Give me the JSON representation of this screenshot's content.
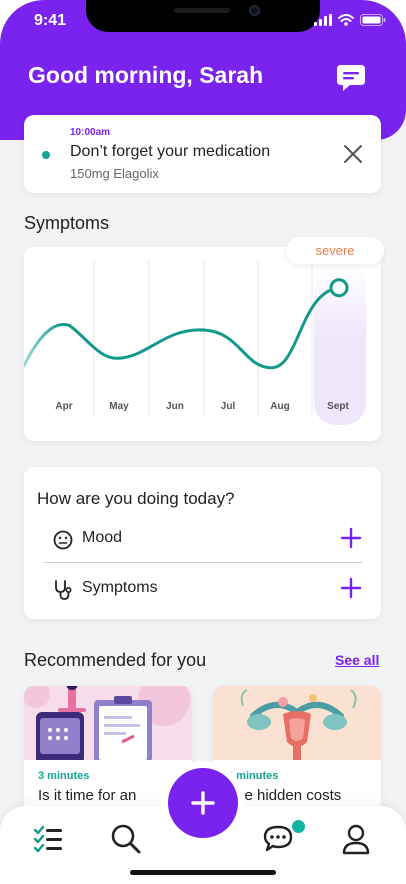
{
  "status_bar": {
    "time": "9:41"
  },
  "header": {
    "greeting": "Good morning, Sarah",
    "chat_icon": "chat-bubble-icon"
  },
  "reminder": {
    "time": "10:00am",
    "title": "Don’t forget your medication",
    "subtitle": "150mg Elagolix"
  },
  "symptoms": {
    "title": "Symptoms",
    "badge": "severe"
  },
  "chart_data": {
    "type": "line",
    "categories": [
      "Apr",
      "May",
      "Jun",
      "Jul",
      "Aug",
      "Sept"
    ],
    "series": [
      {
        "values": [
          0.55,
          0.2,
          0.5,
          0.1,
          0.95
        ]
      }
    ],
    "highlight": "Sept",
    "colors": {
      "line": "#12998b",
      "highlight": "#ece4fb"
    }
  },
  "feeling": {
    "title": "How are you doing today?",
    "rows": [
      {
        "label": "Mood",
        "icon": "neutral-face-icon"
      },
      {
        "label": "Symptoms",
        "icon": "stethoscope-icon"
      }
    ]
  },
  "recommended": {
    "title": "Recommended for you",
    "see_all": "See all",
    "articles": [
      {
        "minutes": "3 minutes",
        "title": "Is it time for an"
      },
      {
        "minutes": "3 minutes",
        "title": "The hidden costs"
      }
    ]
  },
  "colors": {
    "brand": "#7a22ee",
    "accent": "#12a596",
    "severe": "#ee7a4a"
  }
}
